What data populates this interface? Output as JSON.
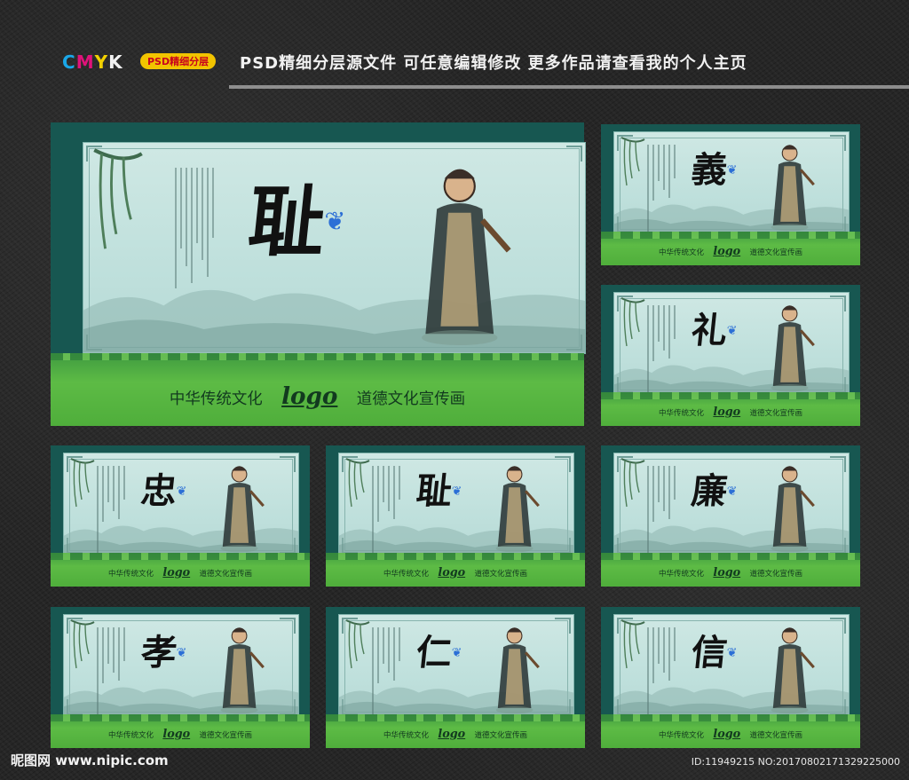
{
  "header": {
    "cmyk_letters": [
      {
        "ch": "C",
        "color": "#1aa7e8"
      },
      {
        "ch": "M",
        "color": "#e0127a"
      },
      {
        "ch": "Y",
        "color": "#f2d000"
      },
      {
        "ch": "K",
        "color": "#f2f2f2"
      }
    ],
    "tag": "PSD精细分层",
    "headline": "PSD精细分层源文件  可任意编辑修改  更多作品请查看我的个人主页"
  },
  "boards": [
    {
      "id": "main",
      "char": "耻",
      "figure": "armored-general-figure",
      "footer_left": "中华传统文化",
      "footer_logo": "logo",
      "footer_right": "道德文化宣传画"
    },
    {
      "id": "yi",
      "char": "義",
      "figure": "sworn-brothers-figure",
      "footer_left": "中华传统文化",
      "footer_logo": "logo",
      "footer_right": "道德文化宣传画"
    },
    {
      "id": "li",
      "char": "礼",
      "figure": "bowing-scholars-figure",
      "footer_left": "中华传统文化",
      "footer_logo": "logo",
      "footer_right": "道德文化宣传画"
    },
    {
      "id": "zhong",
      "char": "忠",
      "figure": "loyal-official-figure",
      "footer_left": "中华传统文化",
      "footer_logo": "logo",
      "footer_right": "道德文化宣传画"
    },
    {
      "id": "chi",
      "char": "耻",
      "figure": "armored-general-figure",
      "footer_left": "中华传统文化",
      "footer_logo": "logo",
      "footer_right": "道德文化宣传画"
    },
    {
      "id": "lian",
      "char": "廉",
      "figure": "robed-official-figure",
      "footer_left": "中华传统文化",
      "footer_logo": "logo",
      "footer_right": "道德文化宣传画"
    },
    {
      "id": "xiao",
      "char": "孝",
      "figure": "filial-son-figure",
      "footer_left": "中华传统文化",
      "footer_logo": "logo",
      "footer_right": "道德文化宣传画"
    },
    {
      "id": "ren",
      "char": "仁",
      "figure": "sage-at-table-figure",
      "footer_left": "中华传统文化",
      "footer_logo": "logo",
      "footer_right": "道德文化宣传画"
    },
    {
      "id": "xin",
      "char": "信",
      "figure": "scholar-under-plum-figure",
      "footer_left": "中华传统文化",
      "footer_logo": "logo",
      "footer_right": "道德文化宣传画"
    }
  ],
  "watermark": "昵图网 www.nipic.com",
  "id_text": "ID:11949215 NO:20170802171329225000",
  "colors": {
    "frame": "#175751",
    "panel": "#c6e3df",
    "green": "#4fae3b",
    "background": "#262626"
  }
}
